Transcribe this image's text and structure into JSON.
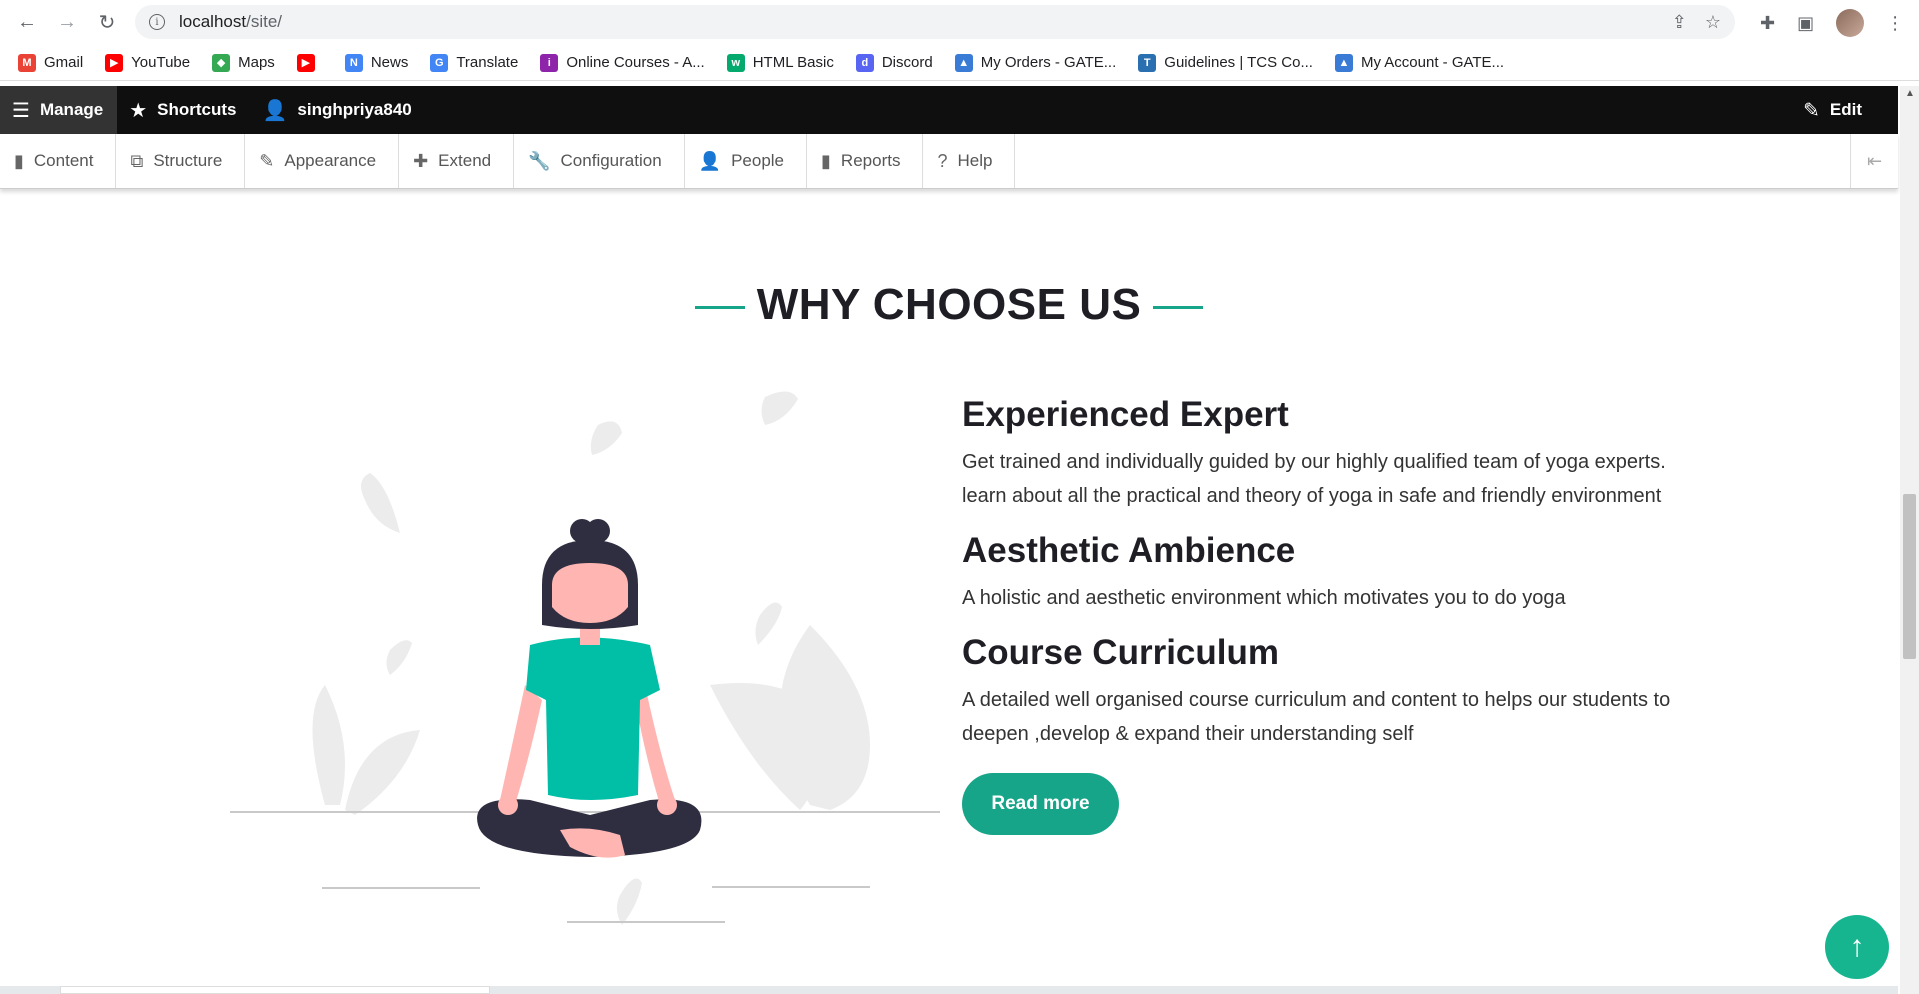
{
  "browser": {
    "url_host": "localhost",
    "url_path": "/site/"
  },
  "bookmarks": [
    {
      "label": "Gmail",
      "color": "#ea4335",
      "glyph": "M"
    },
    {
      "label": "YouTube",
      "color": "#ff0000",
      "glyph": "▶"
    },
    {
      "label": "Maps",
      "color": "#34a853",
      "glyph": "◆"
    },
    {
      "label": "",
      "color": "#ff0000",
      "glyph": "▶"
    },
    {
      "label": "News",
      "color": "#4285f4",
      "glyph": "N"
    },
    {
      "label": "Translate",
      "color": "#4285f4",
      "glyph": "G"
    },
    {
      "label": "Online Courses - A...",
      "color": "#8e24aa",
      "glyph": "i"
    },
    {
      "label": "HTML Basic",
      "color": "#04aa6d",
      "glyph": "w"
    },
    {
      "label": "Discord",
      "color": "#5865f2",
      "glyph": "d"
    },
    {
      "label": "My Orders - GATE...",
      "color": "#3a7bd5",
      "glyph": "▲"
    },
    {
      "label": "Guidelines | TCS Co...",
      "color": "#2a6fb0",
      "glyph": "T"
    },
    {
      "label": "My Account - GATE...",
      "color": "#3a7bd5",
      "glyph": "▲"
    }
  ],
  "toolbar": {
    "manage": "Manage",
    "shortcuts": "Shortcuts",
    "user": "singhpriya840",
    "edit": "Edit"
  },
  "tray": [
    {
      "label": "Content",
      "icon": "file-icon",
      "glyph": "▮"
    },
    {
      "label": "Structure",
      "icon": "sitemap-icon",
      "glyph": "⧉"
    },
    {
      "label": "Appearance",
      "icon": "brush-icon",
      "glyph": "✎"
    },
    {
      "label": "Extend",
      "icon": "puzzle-icon",
      "glyph": "✚"
    },
    {
      "label": "Configuration",
      "icon": "wrench-icon",
      "glyph": "🔧"
    },
    {
      "label": "People",
      "icon": "people-icon",
      "glyph": "👤"
    },
    {
      "label": "Reports",
      "icon": "bar-chart-icon",
      "glyph": "▮"
    },
    {
      "label": "Help",
      "icon": "help-icon",
      "glyph": "?"
    }
  ],
  "section": {
    "title": "WHY CHOOSE US"
  },
  "features": [
    {
      "title": "Experienced Expert",
      "desc": "Get trained and individually guided by our highly qualified team of yoga experts. learn about all the practical and theory of yoga in safe and friendly environment"
    },
    {
      "title": "Aesthetic Ambience",
      "desc": "A holistic and aesthetic environment which motivates you to do yoga"
    },
    {
      "title": "Course Curriculum",
      "desc": "A detailed well organised course curriculum and content to helps our students to deepen ,develop & expand their understanding self"
    }
  ],
  "cta": {
    "label": "Read more"
  },
  "back_to_top": {
    "glyph": "↑"
  },
  "colors": {
    "accent": "#17a589",
    "figure_top": "#00bfa6",
    "skin": "#ffb6b3",
    "dark": "#2f2e41"
  }
}
